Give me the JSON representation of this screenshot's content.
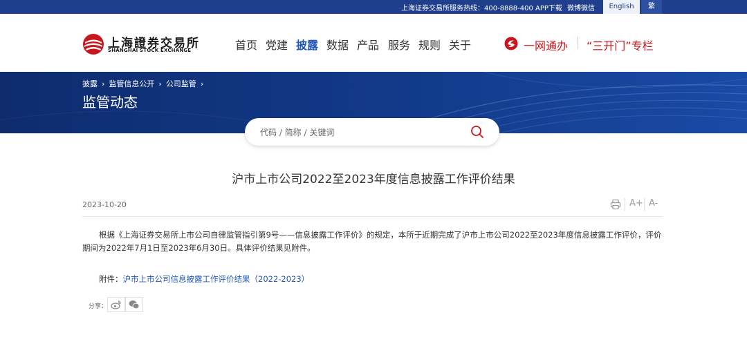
{
  "topbar": {
    "hotline": "上海证券交易所服务热线：400-8888-400",
    "app_download": "APP下载",
    "weibo_weixin": "微博微信",
    "english": "English",
    "traditional": "繁"
  },
  "logo": {
    "cn": "上海證券交易所",
    "en": "SHANGHAI STOCK EXCHANGE"
  },
  "nav": {
    "items": [
      "首页",
      "党建",
      "披露",
      "数据",
      "产品",
      "服务",
      "规则",
      "关于"
    ],
    "active": "披露"
  },
  "header_links": {
    "yiwang": "一网通办",
    "sankai": "“三开门”专栏"
  },
  "breadcrumb": [
    "披露",
    "监管信息公开",
    "公司监管"
  ],
  "banner_title": "监管动态",
  "search": {
    "placeholder": "代码 / 简称 / 关键词"
  },
  "article": {
    "title": "沪市上市公司2022至2023年度信息披露工作评价结果",
    "date": "2023-10-20",
    "tools": {
      "font_up": "A+",
      "font_down": "A-"
    },
    "body": "根据《上海证券交易所上市公司自律监管指引第9号——信息披露工作评价》的规定，本所于近期完成了沪市上市公司2022至2023年度信息披露工作评价，评价期间为2022年7月1日至2023年6月30日。具体评价结果见附件。",
    "attachment_label": "附件：",
    "attachment_link": "沪市上市公司信息披露工作评价结果（2022-2023）",
    "share_label": "分享："
  },
  "colors": {
    "topbar": "#1f3f8c",
    "accent_blue": "#1f56b8",
    "accent_red": "#c8161d",
    "banner": "#123a8a"
  }
}
